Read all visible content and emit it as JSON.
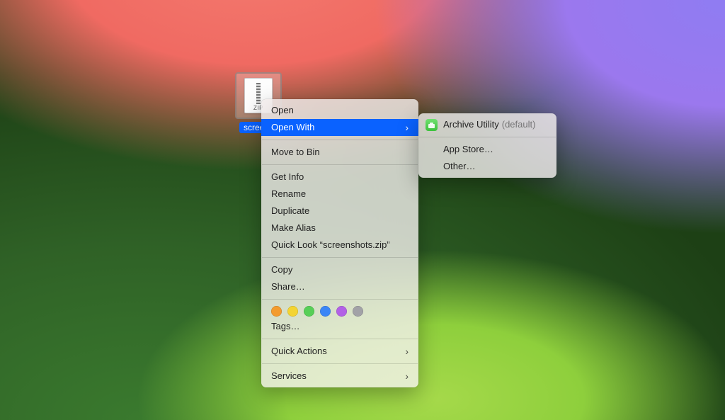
{
  "file": {
    "visible_name": "screens",
    "zip_badge": "ZIP"
  },
  "menu": {
    "open": "Open",
    "open_with": "Open With",
    "move_to_bin": "Move to Bin",
    "get_info": "Get Info",
    "rename": "Rename",
    "duplicate": "Duplicate",
    "make_alias": "Make Alias",
    "quick_look": "Quick Look “screenshots.zip”",
    "copy": "Copy",
    "share": "Share…",
    "tags": "Tags…",
    "quick_actions": "Quick Actions",
    "services": "Services"
  },
  "tags_colors": [
    "#f39b2e",
    "#f3d432",
    "#57cf57",
    "#3b86f6",
    "#b261e6",
    "#a2a2a7"
  ],
  "submenu": {
    "archive_utility": "Archive Utility",
    "default_hint": "(default)",
    "app_store": "App Store…",
    "other": "Other…"
  }
}
